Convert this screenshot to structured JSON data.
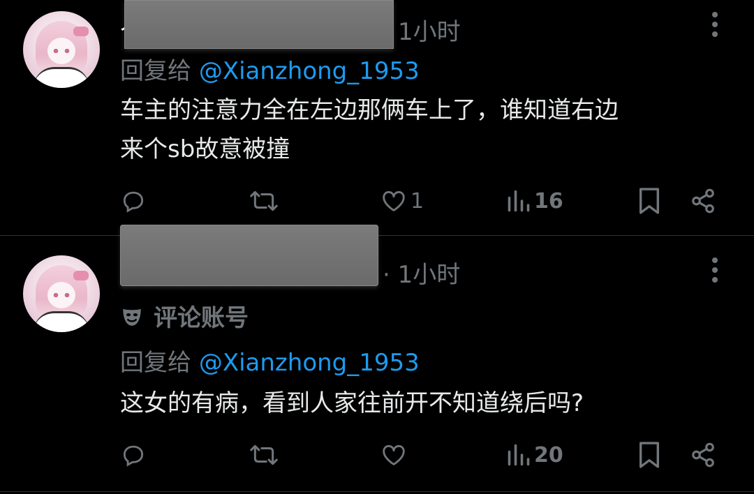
{
  "tweets": [
    {
      "handle_prefix": "个",
      "time": "1小时",
      "reply_to_label": "回复给",
      "reply_to_handle": "@Xianzhong_1953",
      "text_line1": "车主的注意力全在左边那俩车上了，谁知道右边",
      "text_line2": "来个sb故意被撞",
      "actions": {
        "replies": "",
        "retweets": "",
        "likes": "1",
        "views": "16"
      }
    },
    {
      "time": "· 1小时",
      "badge": "评论账号",
      "reply_to_label": "回复给",
      "reply_to_handle": "@Xianzhong_1953",
      "text_line1": "这女的有病，看到人家往前开不知道绕后吗?",
      "actions": {
        "replies": "",
        "retweets": "",
        "likes": "",
        "views": "20"
      }
    }
  ],
  "colors": {
    "background": "#000000",
    "text": "#e7e9ea",
    "muted": "#71767b",
    "link": "#1d9bf0"
  },
  "icons": [
    "more-icon",
    "reply-icon",
    "retweet-icon",
    "like-icon",
    "views-icon",
    "bookmark-icon",
    "share-icon",
    "mask-icon"
  ]
}
